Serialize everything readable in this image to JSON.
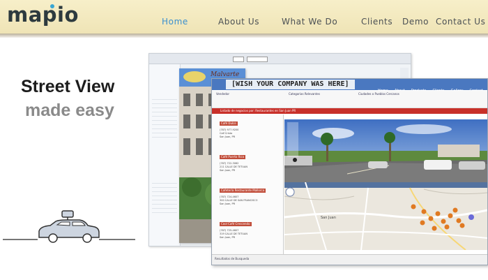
{
  "header": {
    "logo": "mapio",
    "nav": [
      {
        "label": "Home",
        "active": true
      },
      {
        "label": "About Us",
        "active": false
      },
      {
        "label": "What We Do",
        "active": false
      },
      {
        "label": "Clients",
        "active": false
      },
      {
        "label": "Demo",
        "active": false
      },
      {
        "label": "Contact Us",
        "active": false
      }
    ]
  },
  "tagline": {
    "line1": "Street View",
    "line2": "made easy"
  },
  "screenshot": {
    "banner": "[WISH YOUR COMPANY WAS HERE]",
    "top_links": [
      "Home",
      "About",
      "Products",
      "Clients",
      "Gallery",
      "Contact"
    ],
    "mid_title": "Malvarte",
    "red_bar_text": "Listado de negocios por: Restaurantes en San Juan PR",
    "categories_title": "Categorias Relevantes",
    "cities_title": "Ciudades o Pueblos Cercanos",
    "vendedor_title": "Vendedor",
    "listings": [
      {
        "name": "Café Dulce",
        "phone": "(787) 977-9200",
        "street": "Calf Cristo",
        "city": "San Juan, PR"
      },
      {
        "name": "Café Puerto Rico",
        "phone": "(787) 722-3062",
        "street": "211 CALLE DE TETUAN",
        "city": "San Juan, PR"
      },
      {
        "name": "Cafetería Restaurante Mallorca",
        "phone": "(787) 724-4607",
        "street": "300 CALLE DE SAN FRANCISCO",
        "city": "San Juan, PR"
      },
      {
        "name": "Cool Café Crescendo",
        "phone": "(787) 725-4607",
        "street": "319 CALLE DE TETUAN",
        "city": "San Juan, PR"
      }
    ],
    "listing_actions": [
      "ubicar",
      "enviar a amigo",
      "facebook",
      "guardar"
    ],
    "map_city_label": "San Juan",
    "bottom_text": "Resultados de Busqueda",
    "colors": {
      "topbar": "#4a78c0",
      "red_bar": "#c8302a",
      "accent_active_nav": "#3a8fcf",
      "map_marker": "#e07a22"
    }
  }
}
